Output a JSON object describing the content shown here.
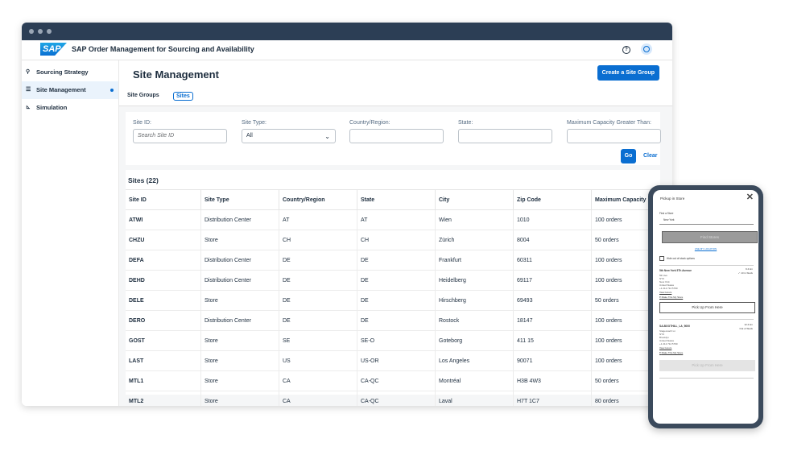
{
  "app": {
    "title": "SAP Order Management for Sourcing and Availability",
    "logo_text": "SAP"
  },
  "sidebar": {
    "items": [
      {
        "label": "Sourcing Strategy",
        "icon": "sourcing-icon"
      },
      {
        "label": "Site Management",
        "icon": "list-icon"
      },
      {
        "label": "Simulation",
        "icon": "chart-icon"
      }
    ]
  },
  "page": {
    "title": "Site Management",
    "create_label": "Create a Site Group"
  },
  "tabs": [
    "Site Groups",
    "Sites"
  ],
  "filters": {
    "site_id": {
      "label": "Site ID:",
      "placeholder": "Search Site ID"
    },
    "site_type": {
      "label": "Site Type:",
      "value": "All"
    },
    "country": {
      "label": "Country/Region:"
    },
    "state": {
      "label": "State:"
    },
    "capacity": {
      "label": "Maximum Capacity Greater Than:"
    },
    "go_label": "Go",
    "clear_label": "Clear"
  },
  "table": {
    "title": "Sites (22)",
    "headers": [
      "Site ID",
      "Site Type",
      "Country/Region",
      "State",
      "City",
      "Zip Code",
      "Maximum Capacity"
    ],
    "rows": [
      [
        "ATWI",
        "Distribution Center",
        "AT",
        "AT",
        "Wien",
        "1010",
        "100 orders"
      ],
      [
        "CHZU",
        "Store",
        "CH",
        "CH",
        "Zürich",
        "8004",
        "50 orders"
      ],
      [
        "DEFA",
        "Distribution Center",
        "DE",
        "DE",
        "Frankfurt",
        "60311",
        "100 orders"
      ],
      [
        "DEHD",
        "Distribution Center",
        "DE",
        "DE",
        "Heidelberg",
        "69117",
        "100 orders"
      ],
      [
        "DELE",
        "Store",
        "DE",
        "DE",
        "Hirschberg",
        "69493",
        "50 orders"
      ],
      [
        "DERO",
        "Distribution Center",
        "DE",
        "DE",
        "Rostock",
        "18147",
        "100 orders"
      ],
      [
        "GOST",
        "Store",
        "SE",
        "SE-O",
        "Goteborg",
        "411 15",
        "100 orders"
      ],
      [
        "LAST",
        "Store",
        "US",
        "US-OR",
        "Los Angeles",
        "90071",
        "100 orders"
      ],
      [
        "MTL1",
        "Store",
        "CA",
        "CA-QC",
        "Montréal",
        "H3B 4W3",
        "50 orders"
      ],
      [
        "MTL2",
        "Store",
        "CA",
        "CA-QC",
        "Laval",
        "H7T 1C7",
        "80 orders"
      ]
    ]
  },
  "phone": {
    "title": "Pickup in Store",
    "input_label": "Find a Store",
    "input_value": "New York",
    "find_label": "Find Stores",
    "location_link": "USE MY LOCATION",
    "checkbox_label": "Hide out of stock options",
    "stores": [
      {
        "name": "5th New York 5Th Avenue",
        "distance": "9.4 km",
        "status": "✓ 10 in Stock",
        "address": [
          "5th Ave",
          "NYK",
          "New York",
          "United States",
          "+1 212 714 5790"
        ],
        "hours": "View Hours",
        "make": "Make This My Store",
        "button": "Pick Up From Here"
      },
      {
        "name": "SA-BOOTHILL_LA_5000",
        "distance": "12.4 km",
        "status": "Out of Stock",
        "address": [
          "Stagecoach Ln",
          "NYK",
          "Brooklyn",
          "United States",
          "+1 212 714 5790"
        ],
        "hours": "View Hours",
        "make": "Make This My Store",
        "button": "Pick Up From Here"
      }
    ]
  },
  "colors": {
    "accent": "#0a6ed1",
    "titlebar": "#2c3e55",
    "phone_frame": "#3b4a5c"
  }
}
